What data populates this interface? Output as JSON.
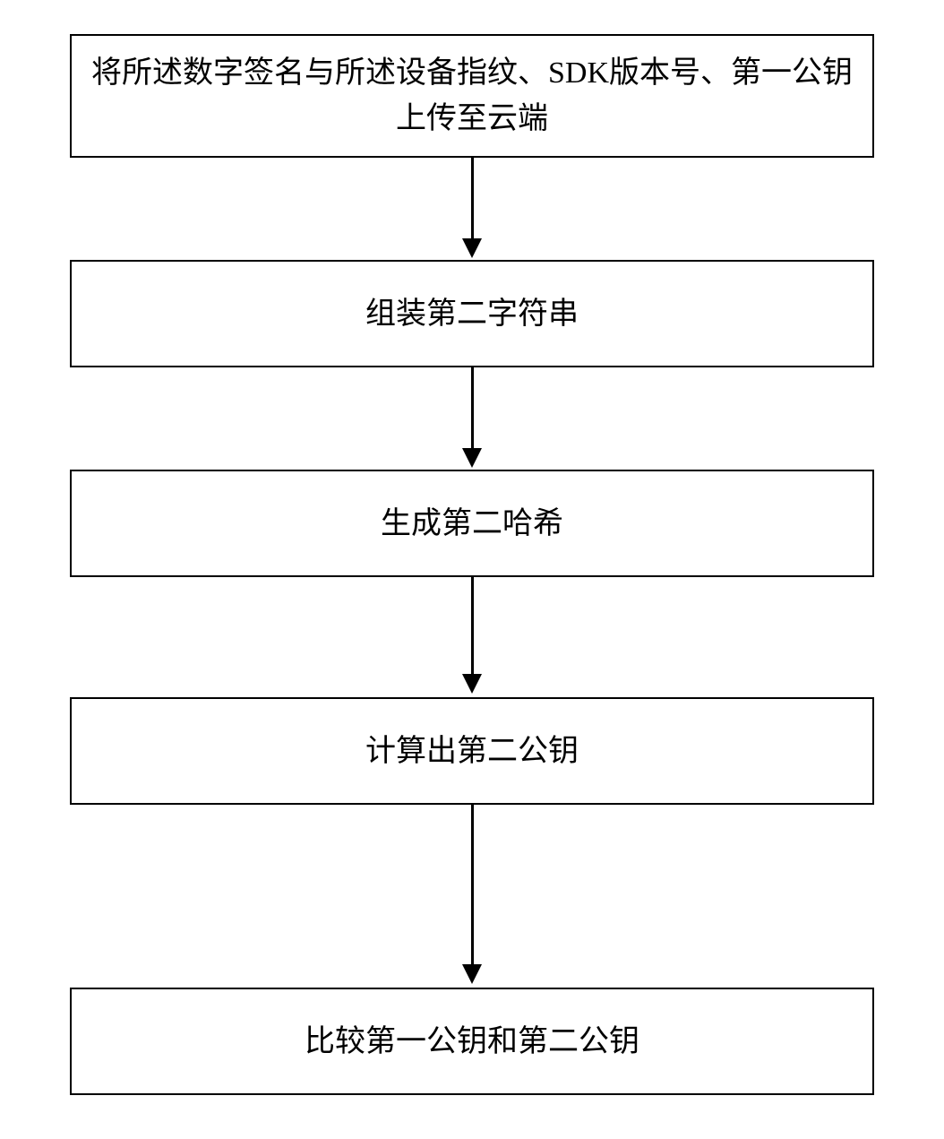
{
  "flow": {
    "steps": [
      {
        "text": "将所述数字签名与所述设备指纹、SDK版本号、第一公钥上传至云端"
      },
      {
        "text": "组装第二字符串"
      },
      {
        "text": "生成第二哈希"
      },
      {
        "text": "计算出第二公钥"
      },
      {
        "text": "比较第一公钥和第二公钥"
      }
    ]
  }
}
